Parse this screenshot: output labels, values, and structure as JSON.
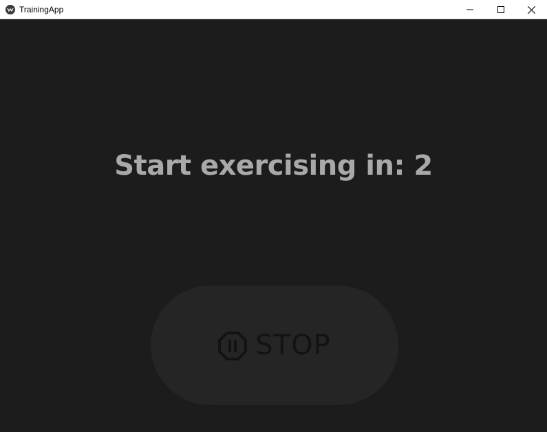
{
  "window": {
    "title": "TrainingApp",
    "app_icon": "app-logo-icon",
    "controls": [
      "minimize-icon",
      "maximize-icon",
      "close-icon"
    ]
  },
  "main": {
    "countdown_text": "Start exercising in: 2",
    "stop_button": {
      "label": "STOP",
      "icon": "stop-octagon-icon"
    }
  },
  "colors": {
    "background": "#1c1c1c",
    "countdown_text": "#a9a9a9",
    "button_bg": "#252525",
    "button_fg": "#131313"
  }
}
